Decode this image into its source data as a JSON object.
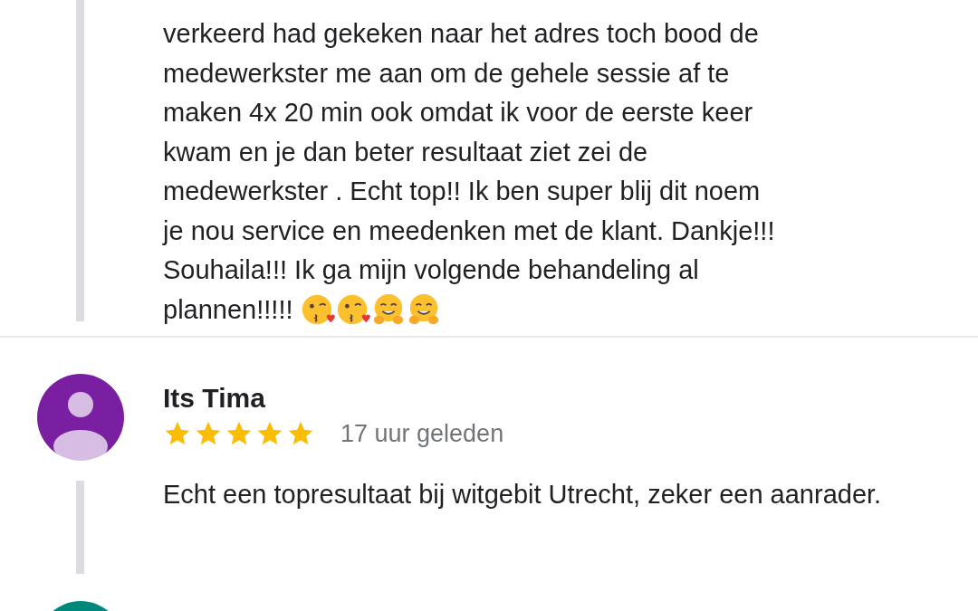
{
  "reviews": [
    {
      "kind": "continued",
      "lines": [
        "verkeerd had gekeken naar het adres toch bood de",
        "medewerkster me aan om de gehele sessie af te",
        "maken 4x 20 min ook omdat ik voor de eerste keer",
        "kwam en je dan beter resultaat ziet zei de",
        "medewerkster . Echt top!! Ik ben super blij dit noem",
        "je nou service en meedenken met de klant. Dankje!!!",
        "Souhaila!!! Ik ga mijn volgende behandeling al",
        "plannen!!!!!"
      ],
      "emojis": [
        {
          "kind": "kiss"
        },
        {
          "kind": "kiss"
        },
        {
          "kind": "hug"
        },
        {
          "kind": "hug"
        }
      ]
    },
    {
      "kind": "full",
      "author": "Its Tima",
      "color": "#7b1fa2",
      "stars": 5,
      "time": "17 uur geleden",
      "text": "Echt een topresultaat bij witgebit Utrecht, zeker een aanrader."
    },
    {
      "kind": "avatar_only",
      "color": "#00897b"
    }
  ]
}
